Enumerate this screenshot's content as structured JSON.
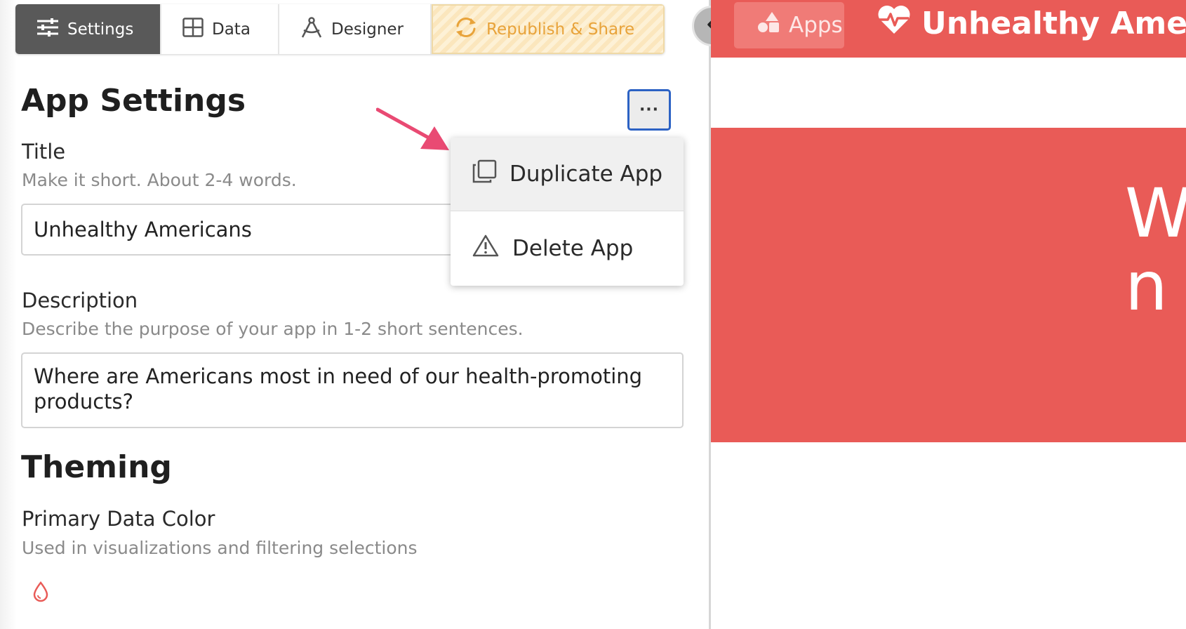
{
  "tabs": {
    "settings": "Settings",
    "data": "Data",
    "designer": "Designer",
    "republish": "Republish & Share"
  },
  "app_settings": {
    "heading": "App Settings",
    "more_label": "···",
    "title_label": "Title",
    "title_hint": "Make it short. About 2-4 words.",
    "title_value": "Unhealthy Americans",
    "description_label": "Description",
    "description_hint": "Describe the purpose of your app in 1-2 short sentences.",
    "description_value": "Where are Americans most in need of our health-promoting products?"
  },
  "menu": {
    "duplicate": "Duplicate App",
    "delete": "Delete App"
  },
  "theming": {
    "heading": "Theming",
    "primary_color_label": "Primary Data Color",
    "primary_color_hint": "Used in visualizations and filtering selections"
  },
  "preview": {
    "apps_label": "Apps",
    "app_title": "Unhealthy Amer",
    "hero_text": "Wh\nn"
  },
  "colors": {
    "brand": "#e95b57",
    "accent_orange": "#e8a33a",
    "focus_blue": "#2c62c4",
    "arrow_pink": "#e94a73"
  }
}
